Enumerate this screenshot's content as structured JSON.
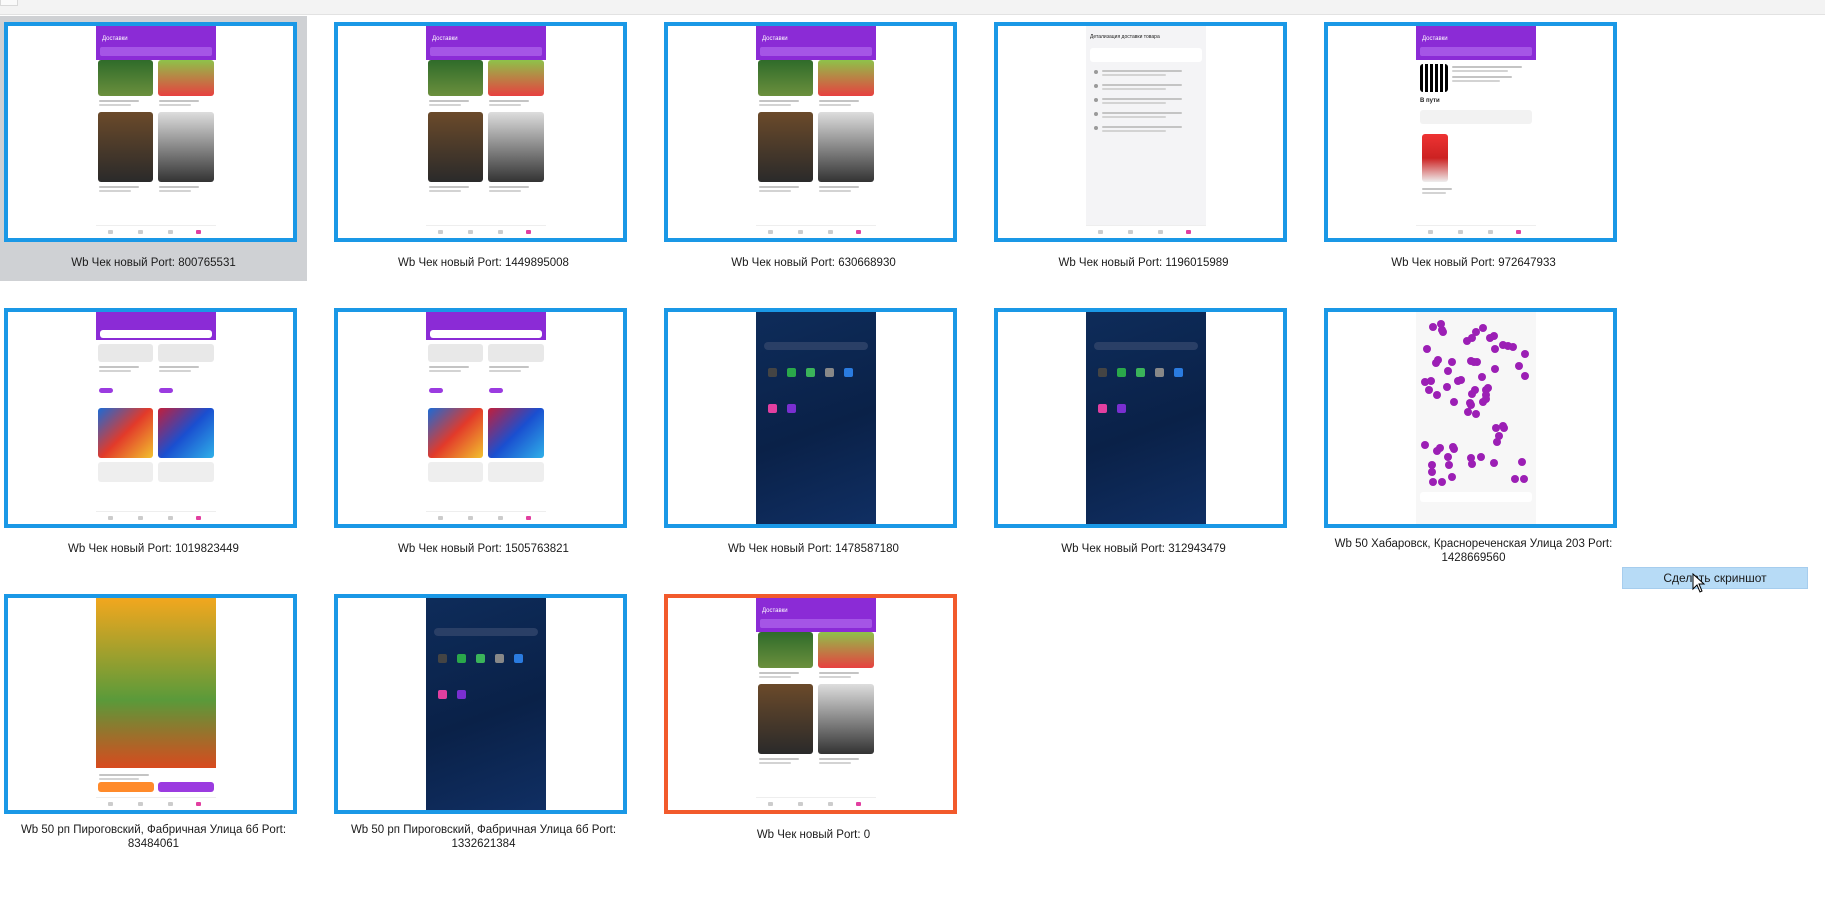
{
  "devices": [
    {
      "caption": "Wb Чек новый Port: 800765531",
      "screen": "delivery",
      "selected": true,
      "active": false
    },
    {
      "caption": "Wb Чек новый Port: 1449895008",
      "screen": "delivery",
      "selected": false,
      "active": false
    },
    {
      "caption": "Wb Чек новый Port: 630668930",
      "screen": "delivery",
      "selected": false,
      "active": false
    },
    {
      "caption": "Wb Чек новый Port: 1196015989",
      "screen": "delivery-detail",
      "selected": false,
      "active": false
    },
    {
      "caption": "Wb Чек новый Port: 972647933",
      "screen": "qr",
      "selected": false,
      "active": false
    },
    {
      "caption": "Wb Чек новый Port: 1019823449",
      "screen": "catalog",
      "selected": false,
      "active": false
    },
    {
      "caption": "Wb Чек новый Port: 1505763821",
      "screen": "catalog",
      "selected": false,
      "active": false
    },
    {
      "caption": "Wb Чек новый Port: 1478587180",
      "screen": "home",
      "selected": false,
      "active": false
    },
    {
      "caption": "Wb Чек новый Port: 312943479",
      "screen": "home",
      "selected": false,
      "active": false
    },
    {
      "caption": "Wb 50 Хабаровск, Краснореченская Улица 203 Port: 1428669560",
      "screen": "dots",
      "selected": false,
      "active": false
    },
    {
      "caption": "Wb 50 рп Пироговский, Фабричная Улица 6б Port: 83484061",
      "screen": "product",
      "selected": false,
      "active": false
    },
    {
      "caption": "Wb 50 рп Пироговский, Фабричная Улица 6б Port: 1332621384",
      "screen": "home",
      "selected": false,
      "active": false
    },
    {
      "caption": "Wb Чек новый Port: 0",
      "screen": "delivery",
      "selected": false,
      "active": true
    }
  ],
  "phone": {
    "delivery_title": "Доставки",
    "detail_title": "Детализация доставки товара",
    "in_transit": "В пути"
  },
  "screenshot_button": {
    "label": "Сделать скриншот"
  },
  "colors": {
    "thumb_border": "#1a98e6",
    "active_border": "#f25a2c",
    "brand_purple": "#8b2bd6",
    "button_bg": "#b7dbf6"
  }
}
